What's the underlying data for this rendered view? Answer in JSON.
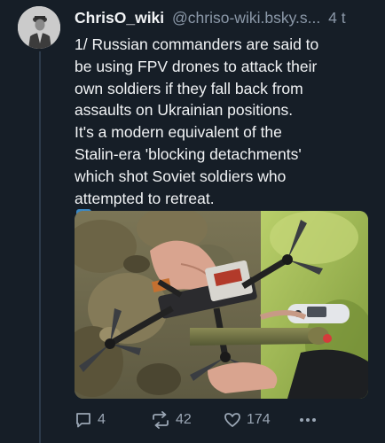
{
  "post": {
    "display_name": "ChrisO_wiki",
    "handle": "@chriso-wiki.bsky.s...",
    "timestamp": "4 t",
    "text_lines": [
      "1/ Russian commanders are said to",
      "be using FPV drones to attack their",
      "own soldiers if they fall back from",
      "assaults on Ukrainian positions.",
      "It's a modern equivalent of the",
      "Stalin-era 'blocking detachments'",
      "which shot Soviet soldiers who",
      "attempted to retreat."
    ],
    "emoji": "arrow-down-emoji",
    "image": "fpv-drone-photo"
  },
  "actions": {
    "reply_count": "4",
    "repost_count": "42",
    "like_count": "174"
  },
  "colors": {
    "background": "#161e27",
    "text": "#f1f3f5",
    "secondary_text": "#8b98a8",
    "action_icon": "#9aa6b4",
    "thread_line": "#2c3a4a"
  }
}
